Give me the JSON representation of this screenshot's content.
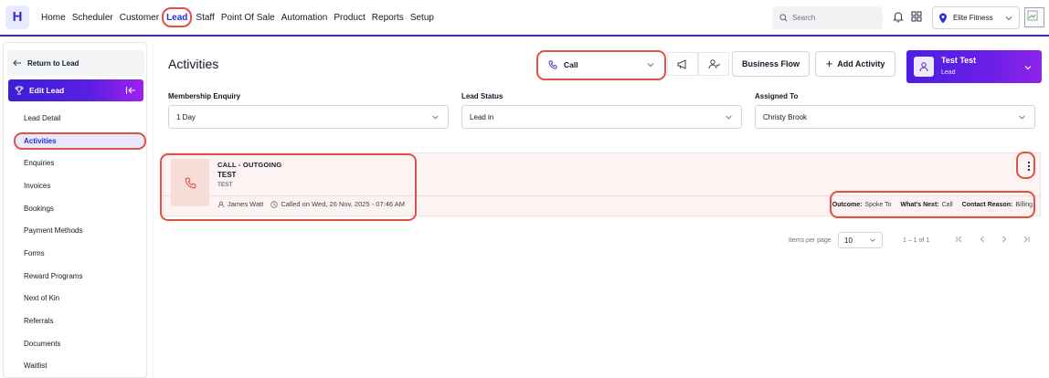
{
  "app": {
    "logo_letter": "H",
    "brand_color": "#2e2bd6",
    "highlight_color": "#e05241"
  },
  "nav": {
    "items": [
      "Home",
      "Scheduler",
      "Customer",
      "Lead",
      "Staff",
      "Point Of Sale",
      "Automation",
      "Product",
      "Reports",
      "Setup"
    ],
    "active": "Lead"
  },
  "header": {
    "search_placeholder": "Search",
    "location": "Elite Fitness",
    "icons": [
      "search-icon",
      "bell-icon",
      "grid-icon",
      "location-pin-icon",
      "chevron-down-icon"
    ]
  },
  "sidebar": {
    "return_label": "Return to Lead",
    "section_label": "Edit Lead",
    "items": [
      "Lead Detail",
      "Activities",
      "Enquiries",
      "Invoices",
      "Bookings",
      "Payment Methods",
      "Forms",
      "Reward Programs",
      "Next of Kin",
      "Referrals",
      "Documents",
      "Waitlist"
    ],
    "active": "Activities"
  },
  "main": {
    "title": "Activities",
    "activity_type": "Call",
    "business_flow_label": "Business Flow",
    "add_activity_label": "Add Activity",
    "lead": {
      "name": "Test Test",
      "role": "Lead"
    },
    "filters": [
      {
        "label": "Membership Enquiry",
        "value": "1 Day"
      },
      {
        "label": "Lead Status",
        "value": "Lead in"
      },
      {
        "label": "Assigned To",
        "value": "Christy Brook"
      }
    ]
  },
  "activity": {
    "heading": "CALL - OUTGOING",
    "subject": "TEST",
    "description": "TEST",
    "staff": "James Watt",
    "called_on": "Called on Wed, 26 Nov, 2025 - 07:46 AM",
    "outcome_label": "Outcome:",
    "outcome_value": "Spoke To",
    "whats_next_label": "What's Next:",
    "whats_next_value": "Call",
    "contact_reason_label": "Contact Reason:",
    "contact_reason_value": "Billing"
  },
  "pagination": {
    "items_per_page_label": "Items per page",
    "items_per_page": "10",
    "range": "1 – 1 of 1"
  }
}
